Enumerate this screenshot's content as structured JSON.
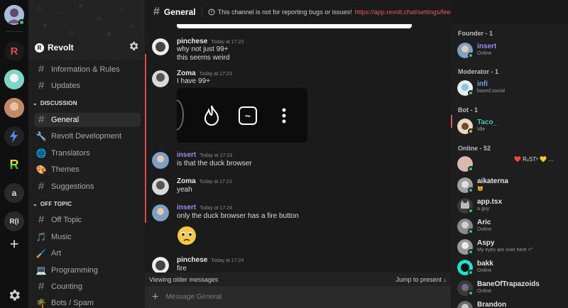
{
  "servers": [
    {
      "name": "home",
      "label": ""
    },
    {
      "name": "revolt",
      "label": "R"
    },
    {
      "name": "server-teal",
      "label": ""
    },
    {
      "name": "server-brown",
      "label": ""
    },
    {
      "name": "server-bolt",
      "label": ""
    },
    {
      "name": "server-rainbow",
      "label": "R"
    },
    {
      "name": "server-a",
      "label": "a"
    },
    {
      "name": "server-ri",
      "label": "R(I"
    }
  ],
  "sidebar": {
    "server_name": "Revolt",
    "channels_top": [
      {
        "label": "Information & Rules",
        "icon": "hash-icon"
      },
      {
        "label": "Updates",
        "icon": "hash-icon"
      }
    ],
    "cat_discussion": "DISCUSSION",
    "channels_discussion": [
      {
        "label": "General",
        "icon": "hash-icon"
      },
      {
        "label": "Revolt Development",
        "icon": "wrench-icon"
      },
      {
        "label": "Translators",
        "icon": "globe-icon"
      },
      {
        "label": "Themes",
        "icon": "palette-icon"
      },
      {
        "label": "Suggestions",
        "icon": "hash-icon"
      }
    ],
    "cat_offtopic": "OFF TOPIC",
    "channels_offtopic": [
      {
        "label": "Off Topic",
        "icon": "hash-icon"
      },
      {
        "label": "Music",
        "icon": "music-note-icon"
      },
      {
        "label": "Art",
        "icon": "brush-icon"
      },
      {
        "label": "Programming",
        "icon": "laptop-icon"
      },
      {
        "label": "Counting",
        "icon": "hash-icon"
      },
      {
        "label": "Bots / Spam",
        "icon": "palm-tree-icon"
      }
    ]
  },
  "header": {
    "channel": "General",
    "notice": "This channel is not for reporting bugs or issues!",
    "notice_link": "https://app.revolt.chat/settings/feedback"
  },
  "messages": [
    {
      "author": "pinchese",
      "time": "Today at 17:23",
      "lines": [
        "why not just 99+",
        "this seems weird"
      ]
    },
    {
      "author": "Zoma",
      "time": "Today at 17:23",
      "lines": [
        "I have 99+"
      ]
    },
    {
      "author": "insert",
      "time": "Today at 17:23",
      "lines": [
        "is that the duck browser"
      ]
    },
    {
      "author": "Zoma",
      "time": "Today at 17:23",
      "lines": [
        "yeah"
      ]
    },
    {
      "author": "insert",
      "time": "Today at 17:24",
      "lines": [
        "only the duck browser has a fire button"
      ]
    },
    {
      "author": "pinchese",
      "time": "Today at 17:24",
      "lines": [
        "fire"
      ]
    }
  ],
  "embed_label": "~",
  "composer": {
    "older": "Viewing older messages",
    "jump": "Jump to present",
    "placeholder": "Message General"
  },
  "members": {
    "founder_head": "Founder - 1",
    "moderator_head": "Moderator - 1",
    "bot_head": "Bot - 1",
    "online_head": "Online - 52",
    "founder": {
      "name": "insert",
      "status": "Online"
    },
    "moderator": {
      "name": "infi",
      "status": "based.social"
    },
    "bot": {
      "name": "Taco_",
      "status": "Idle"
    },
    "online": [
      {
        "name": "",
        "status": ""
      },
      {
        "name": "aikaterna",
        "status": "😺"
      },
      {
        "name": "app.tsx",
        "status": "a guy"
      },
      {
        "name": "Aric",
        "status": "Online"
      },
      {
        "name": "Aspy",
        "status": "My eyes are over here <\""
      },
      {
        "name": "bakk",
        "status": "Online"
      },
      {
        "name": "BaneOfTrapazoids",
        "status": "Online"
      },
      {
        "name": "Brandon",
        "status": ""
      }
    ],
    "blank_deco": "❤️ RₑSTᵞ 💛 …"
  },
  "colors": {
    "accent": "#e45a5a",
    "online": "#3abf7e",
    "mention": "#9a8cf0",
    "bot": "#4fc1a6"
  }
}
